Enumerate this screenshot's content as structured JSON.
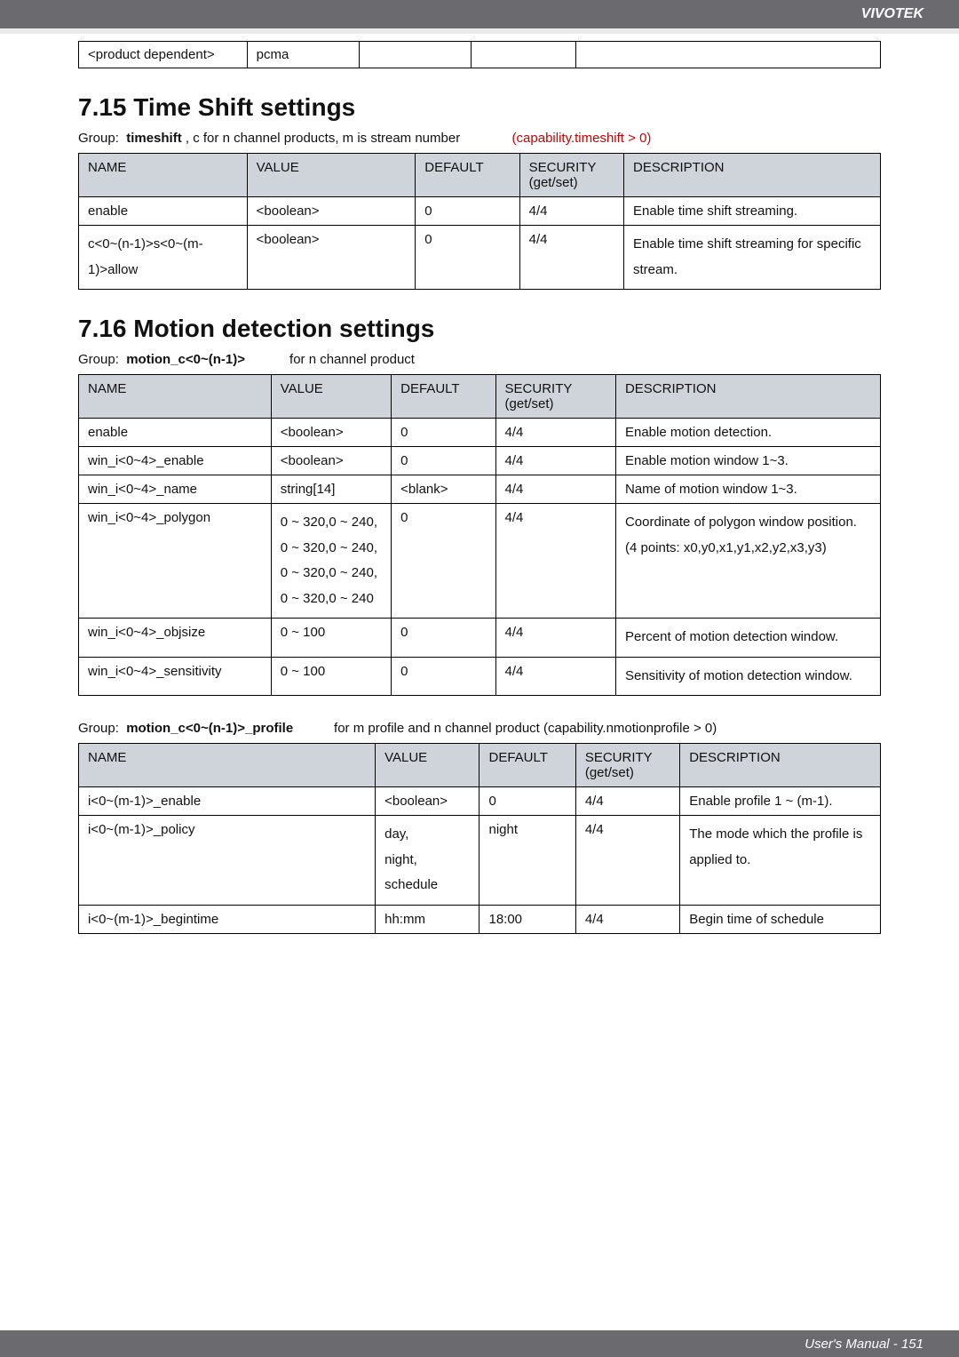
{
  "header": {
    "brand": "VIVOTEK"
  },
  "footer": {
    "text": "User's Manual - 151"
  },
  "top_row": {
    "c1": "<product dependent>",
    "c2": "pcma",
    "c3": "",
    "c4": "",
    "c5": ""
  },
  "section_715": {
    "title": "7.15 Time Shift settings",
    "group_prefix": "Group:",
    "group_name": "timeshift",
    "group_note": ", c for n channel products, m is stream number",
    "group_cap": "(capability.timeshift > 0)",
    "headers": {
      "name": "NAME",
      "value": "VALUE",
      "default": "DEFAULT",
      "security": "SECURITY",
      "description": "DESCRIPTION"
    },
    "security_sub": "(get/set)",
    "rows": [
      {
        "name": "enable",
        "value": "<boolean>",
        "default": "0",
        "security": "4/4",
        "desc": "Enable time shift streaming."
      },
      {
        "name": "c<0~(n-1)>s<0~(m-1)>allow",
        "value": "<boolean>",
        "default": "0",
        "security": "4/4",
        "desc": "Enable time shift streaming for specific stream."
      }
    ]
  },
  "section_716": {
    "title": "7.16 Motion detection settings",
    "group_line1_prefix": "Group:",
    "group_line1_name": "motion_c<0~(n-1)>",
    "group_line1_note": "for n channel product",
    "headers": {
      "name": "NAME",
      "value": "VALUE",
      "default": "DEFAULT",
      "security": "SECURITY",
      "description": "DESCRIPTION"
    },
    "security_sub": "(get/set)",
    "rows": [
      {
        "name": "enable",
        "value": "<boolean>",
        "default": "0",
        "security": "4/4",
        "desc": "Enable motion detection."
      },
      {
        "name": "win_i<0~4>_enable",
        "value": "<boolean>",
        "default": "0",
        "security": "4/4",
        "desc": "Enable motion window 1~3."
      },
      {
        "name": "win_i<0~4>_name",
        "value": "string[14]",
        "default": "<blank>",
        "security": "4/4",
        "desc": "Name of motion window 1~3."
      },
      {
        "name": "win_i<0~4>_polygon",
        "value": "0 ~ 320,0 ~ 240, 0 ~ 320,0 ~ 240, 0 ~ 320,0 ~ 240, 0 ~ 320,0 ~ 240",
        "default": "0",
        "security": "4/4",
        "desc": "Coordinate of polygon window position.\n(4 points: x0,y0,x1,y1,x2,y2,x3,y3)"
      },
      {
        "name": "win_i<0~4>_objsize",
        "value": "0 ~ 100",
        "default": "0",
        "security": "4/4",
        "desc": "Percent of motion detection window."
      },
      {
        "name": "win_i<0~4>_sensitivity",
        "value": "0 ~ 100",
        "default": "0",
        "security": "4/4",
        "desc": "Sensitivity of motion detection window."
      }
    ],
    "group_line2_prefix": "Group:",
    "group_line2_name": "motion_c<0~(n-1)>_profile",
    "group_line2_note": "for m profile and n channel product (capability.nmotionprofile > 0)",
    "rows2": [
      {
        "name": "i<0~(m-1)>_enable",
        "value": "<boolean>",
        "default": "0",
        "security": "4/4",
        "desc": "Enable profile 1 ~ (m-1)."
      },
      {
        "name": "i<0~(m-1)>_policy",
        "value": "day,\nnight,\nschedule",
        "default": "night",
        "security": "4/4",
        "desc": "The mode which the profile is applied to."
      },
      {
        "name": "i<0~(m-1)>_begintime",
        "value": "hh:mm",
        "default": "18:00",
        "security": "4/4",
        "desc": "Begin time of schedule"
      }
    ]
  }
}
